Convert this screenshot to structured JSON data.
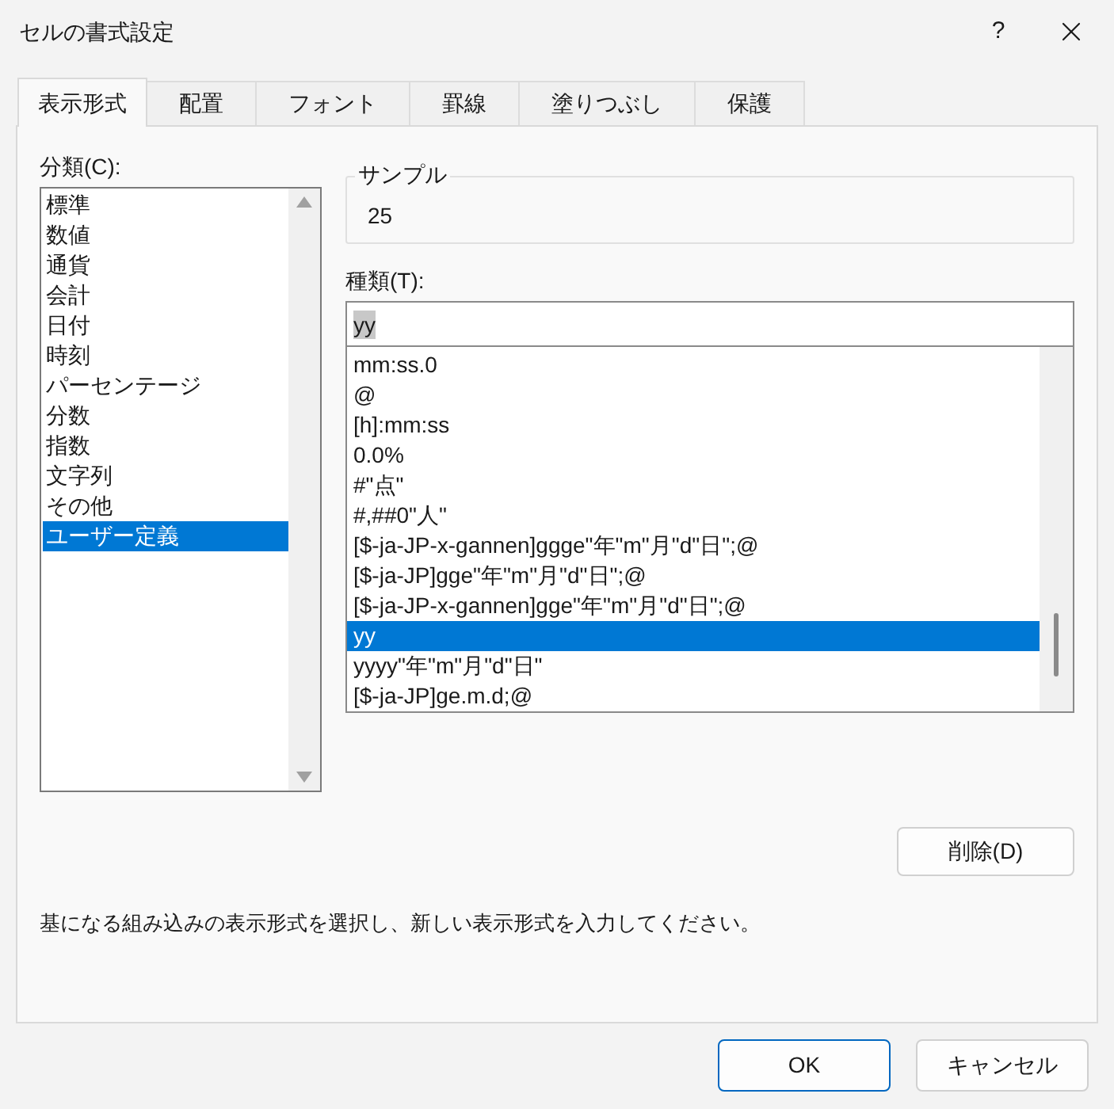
{
  "window": {
    "title": "セルの書式設定",
    "help": "?"
  },
  "tabs": [
    {
      "label": "表示形式",
      "selected": true
    },
    {
      "label": "配置",
      "selected": false
    },
    {
      "label": "フォント",
      "selected": false
    },
    {
      "label": "罫線",
      "selected": false
    },
    {
      "label": "塗りつぶし",
      "selected": false
    },
    {
      "label": "保護",
      "selected": false
    }
  ],
  "category": {
    "label": "分類(C):",
    "items": [
      {
        "label": "標準",
        "selected": false
      },
      {
        "label": "数値",
        "selected": false
      },
      {
        "label": "通貨",
        "selected": false
      },
      {
        "label": "会計",
        "selected": false
      },
      {
        "label": "日付",
        "selected": false
      },
      {
        "label": "時刻",
        "selected": false
      },
      {
        "label": "パーセンテージ",
        "selected": false
      },
      {
        "label": "分数",
        "selected": false
      },
      {
        "label": "指数",
        "selected": false
      },
      {
        "label": "文字列",
        "selected": false
      },
      {
        "label": "その他",
        "selected": false
      },
      {
        "label": "ユーザー定義",
        "selected": true
      }
    ]
  },
  "sample": {
    "label": "サンプル",
    "value": "25"
  },
  "type": {
    "label": "種類(T):",
    "value": "yy",
    "items": [
      {
        "label": "mm:ss.0",
        "selected": false
      },
      {
        "label": "@",
        "selected": false
      },
      {
        "label": "[h]:mm:ss",
        "selected": false
      },
      {
        "label": "0.0%",
        "selected": false
      },
      {
        "label": "#\"点\"",
        "selected": false
      },
      {
        "label": "#,##0\"人\"",
        "selected": false
      },
      {
        "label": "[$-ja-JP-x-gannen]ggge\"年\"m\"月\"d\"日\";@",
        "selected": false
      },
      {
        "label": "[$-ja-JP]gge\"年\"m\"月\"d\"日\";@",
        "selected": false
      },
      {
        "label": "[$-ja-JP-x-gannen]gge\"年\"m\"月\"d\"日\";@",
        "selected": false
      },
      {
        "label": "yy",
        "selected": true
      },
      {
        "label": "yyyy\"年\"m\"月\"d\"日\"",
        "selected": false
      },
      {
        "label": "[$-ja-JP]ge.m.d;@",
        "selected": false
      }
    ]
  },
  "delete_button": "削除(D)",
  "hint": "基になる組み込みの表示形式を選択し、新しい表示形式を入力してください。",
  "buttons": [
    {
      "label": "OK",
      "kind": "default"
    },
    {
      "label": "キャンセル",
      "kind": "normal"
    }
  ]
}
